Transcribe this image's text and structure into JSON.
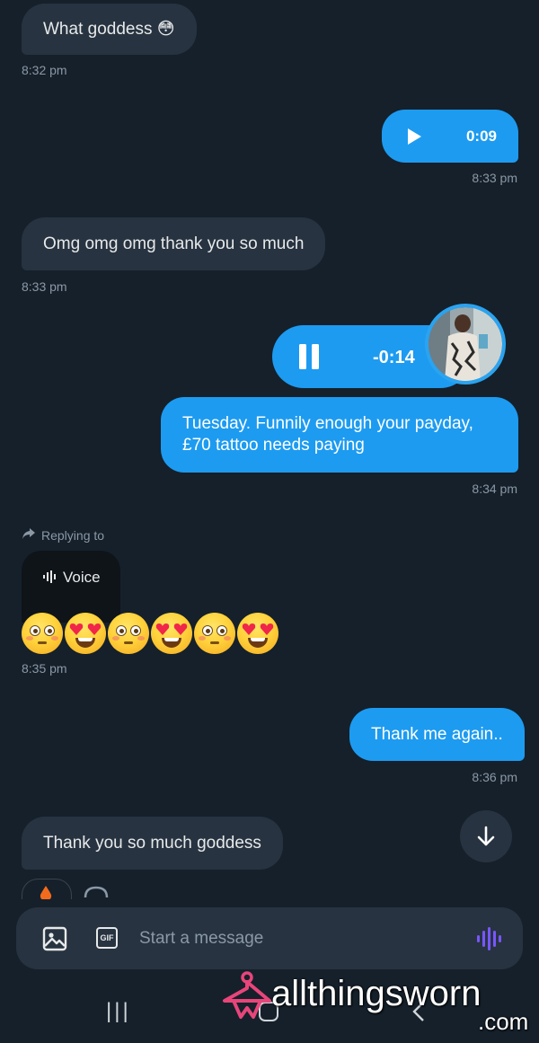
{
  "messages": {
    "m1": {
      "text": "What goddess 😳",
      "time": "8:32 pm"
    },
    "m2": {
      "duration": "0:09",
      "time": "8:33 pm"
    },
    "m3": {
      "text": "Omg omg omg thank you so much",
      "time": "8:33 pm"
    },
    "m4": {
      "remaining": "-0:14"
    },
    "m5": {
      "text": "Tuesday. Funnily enough your payday, £70 tattoo needs paying",
      "time": "8:34 pm"
    },
    "m6": {
      "replying_label": "Replying to",
      "quoted_label": "Voice",
      "time": "8:35 pm"
    },
    "m7": {
      "text": "Thank me again..",
      "time": "8:36 pm"
    },
    "m8": {
      "text": "Thank you so much goddess"
    }
  },
  "composer": {
    "placeholder": "Start a message",
    "gif_label": "GIF"
  },
  "watermark": {
    "brand": "allthingsworn",
    "suffix": ".com"
  },
  "nav": {
    "recents_glyph": "|||"
  },
  "colors": {
    "background": "#15202b",
    "incoming": "#273340",
    "outgoing": "#1d9bf0",
    "mic_accent": "#7856ff",
    "brand_pink": "#e8457a"
  },
  "icons": [
    "play-icon",
    "pause-icon",
    "reply-arrow-icon",
    "voice-wave-icon",
    "image-icon",
    "gif-icon",
    "voice-record-icon",
    "arrow-down-icon",
    "hanger-icon"
  ]
}
